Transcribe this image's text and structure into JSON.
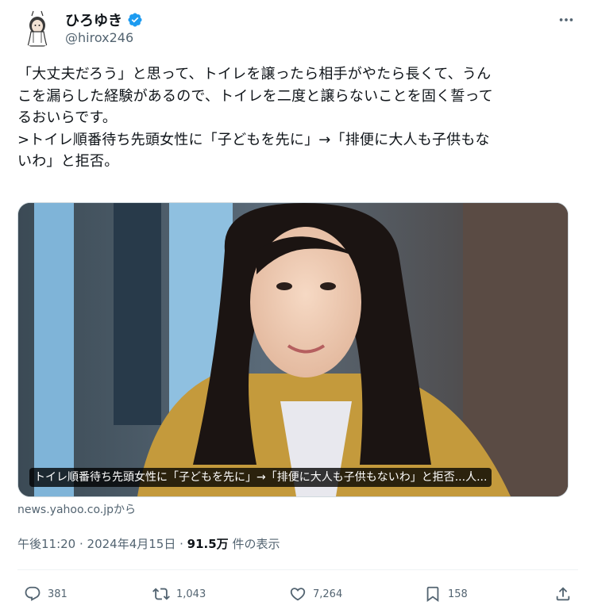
{
  "author": {
    "name": "ひろゆき",
    "handle": "@hirox246",
    "verified_color": "#1d9bf0"
  },
  "more_icon": "more-horizontal-icon",
  "tweet": {
    "text": "「大丈夫だろう」と思って、トイレを譲ったら相手がやたら長くて、うん\nこを漏らした経験があるので、トイレを二度と譲らないことを固く誓って\nるおいらです。\n>トイレ順番待ち先頭女性に「子どもを先に」→「排便に大人も子供もな\nいわ」と拒否。"
  },
  "card": {
    "caption": "トイレ順番待ち先頭女性に「子どもを先に」→「排便に大人も子供もないわ」と拒否...人...",
    "source": "news.yahoo.co.jpから"
  },
  "meta": {
    "time_date": "午後11:20 · 2024年4月15日 · ",
    "views_count": "91.5万",
    "views_label": " 件の表示"
  },
  "actions": {
    "replies": "381",
    "reposts": "1,043",
    "likes": "7,264",
    "bookmarks": "158"
  },
  "colors": {
    "text": "#0f1419",
    "secondary": "#536471",
    "border": "#cfd9de",
    "verified": "#1d9bf0"
  }
}
